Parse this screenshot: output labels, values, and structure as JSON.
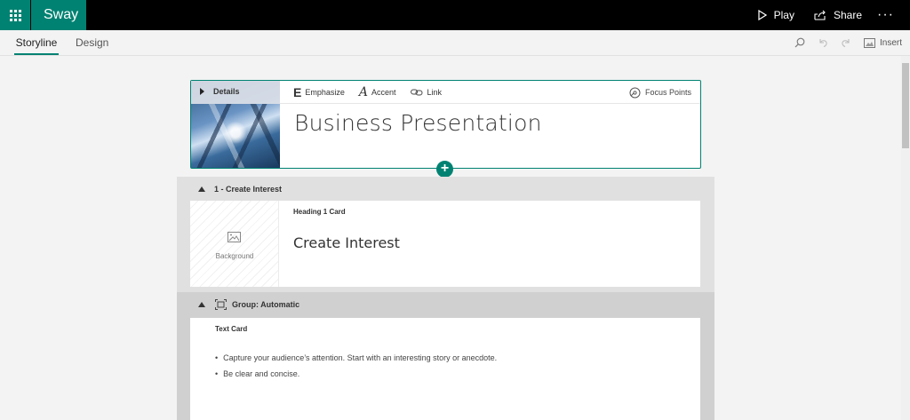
{
  "app": {
    "name": "Sway",
    "accent": "#008272",
    "play_label": "Play",
    "share_label": "Share",
    "more_label": "···"
  },
  "tabs": [
    {
      "label": "Storyline",
      "active": true
    },
    {
      "label": "Design",
      "active": false
    }
  ],
  "toolbar": {
    "insert_label": "Insert",
    "icons": [
      "search-icon",
      "undo-icon",
      "redo-icon",
      "insert-image-icon"
    ]
  },
  "title_card": {
    "details_label": "Details",
    "format_buttons": [
      {
        "glyph": "E",
        "label": "Emphasize",
        "icon": "emphasize-icon"
      },
      {
        "glyph": "A",
        "label": "Accent",
        "icon": "accent-icon"
      },
      {
        "glyph": "",
        "label": "Link",
        "icon": "link-icon"
      }
    ],
    "focus_points_label": "Focus Points",
    "title": "Business Presentation",
    "add_label": "+"
  },
  "section1": {
    "header": "1 - Create Interest",
    "card_type": "Heading 1 Card",
    "card_title": "Create Interest",
    "background_label": "Background"
  },
  "group": {
    "header": "Group: Automatic",
    "card_type": "Text Card",
    "bullets": [
      "Capture your audience’s attention.  Start with an interesting story or anecdote.",
      "Be clear and concise."
    ]
  }
}
